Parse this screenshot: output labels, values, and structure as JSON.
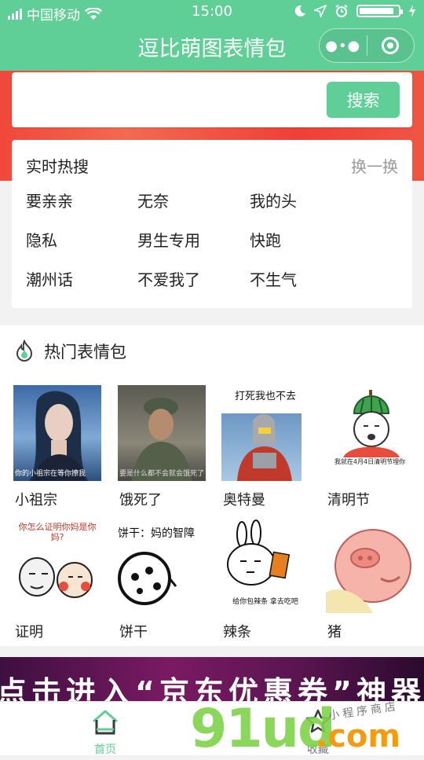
{
  "status_bar": {
    "carrier": "中国移动",
    "time": "15:00",
    "battery_level": 0.9
  },
  "nav": {
    "title": "逗比萌图表情包",
    "more_icon": "more-dots-icon",
    "close_icon": "circle-close-icon"
  },
  "search": {
    "placeholder": "",
    "button_label": "搜索"
  },
  "hot_search": {
    "title": "实时热搜",
    "switch_label": "换一换",
    "keywords": [
      "要亲亲",
      "无奈",
      "我的头",
      "隐私",
      "男生专用",
      "快跑",
      "潮州话",
      "不爱我了",
      "不生气"
    ]
  },
  "popular": {
    "title": "热门表情包",
    "items": [
      {
        "caption": "小祖宗",
        "thumb_text": "你的小祖宗在等你撩我"
      },
      {
        "caption": "饿死了",
        "thumb_text": "要是什么都不会就会饿死了"
      },
      {
        "caption": "奥特曼",
        "thumb_text": "打死我也不去"
      },
      {
        "caption": "清明节",
        "thumb_text": "我就在4月4日清明节埋你"
      },
      {
        "caption": "证明",
        "thumb_text": "你怎么证明你妈是你妈?"
      },
      {
        "caption": "饼干",
        "thumb_text": "饼干：妈的智障"
      },
      {
        "caption": "辣条",
        "thumb_text": "给你包辣条 拿去吃吧"
      },
      {
        "caption": "猪",
        "thumb_text": ""
      }
    ]
  },
  "banner": {
    "text": "点击进入“京东优惠券”神器"
  },
  "tabbar": {
    "home_label": "首页",
    "favorites_label": "收藏"
  },
  "watermark": {
    "brand": "91ud",
    "domain": ".com",
    "tagline": "小程序商店"
  },
  "colors": {
    "brand_green": "#5fcf97",
    "banner_purple": "#5a1550"
  }
}
